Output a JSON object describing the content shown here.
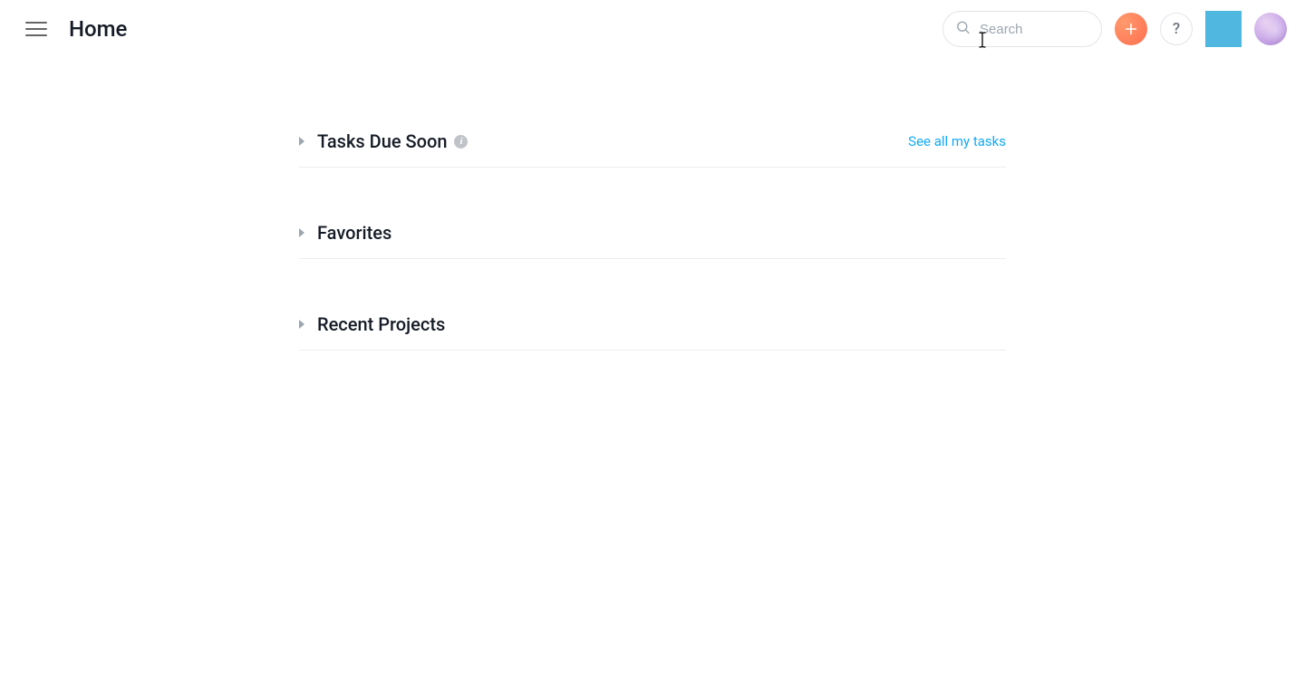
{
  "header": {
    "title": "Home",
    "search_placeholder": "Search",
    "help_label": "?",
    "info_glyph": "i"
  },
  "sections": {
    "tasks": {
      "title": "Tasks Due Soon",
      "link": "See all my tasks"
    },
    "favorites": {
      "title": "Favorites"
    },
    "recent": {
      "title": "Recent Projects"
    }
  }
}
